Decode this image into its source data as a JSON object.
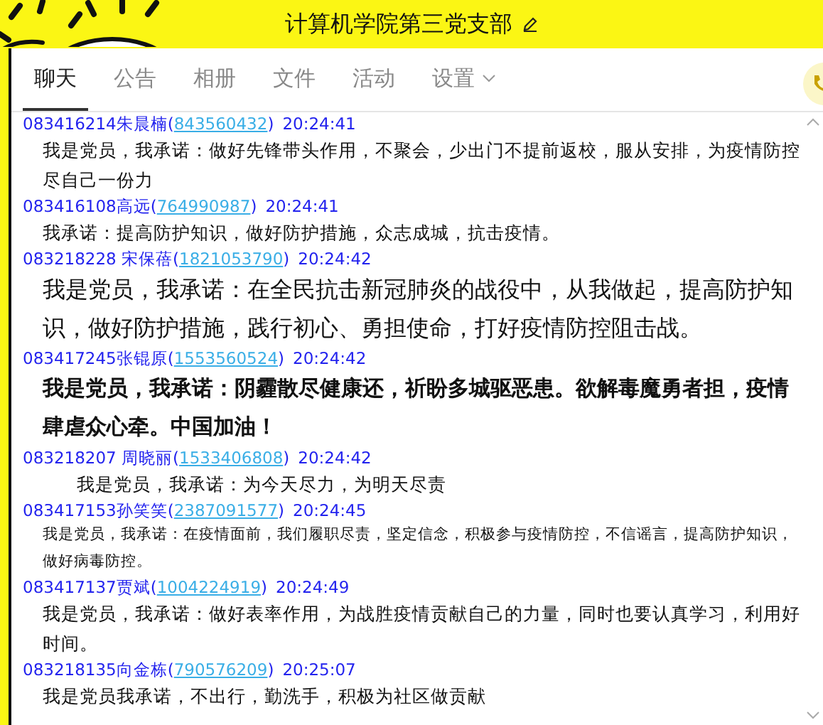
{
  "window": {
    "title": "计算机学院第三党支部"
  },
  "tabs": [
    {
      "label": "聊天",
      "selected": true,
      "dropdown": false
    },
    {
      "label": "公告",
      "selected": false,
      "dropdown": false
    },
    {
      "label": "相册",
      "selected": false,
      "dropdown": false
    },
    {
      "label": "文件",
      "selected": false,
      "dropdown": false
    },
    {
      "label": "活动",
      "selected": false,
      "dropdown": false
    },
    {
      "label": "设置",
      "selected": false,
      "dropdown": true
    }
  ],
  "messages": [
    {
      "sender": "083416214朱晨楠(",
      "qq": "843560432",
      "qq_close": ")",
      "time": "20:24:41",
      "text": "我是党员，我承诺：做好先锋带头作用，不聚会，少出门不提前返校，服从安排，为疫情防控尽自己一份力",
      "kind": "normal",
      "indented": false
    },
    {
      "sender": "083416108高远(",
      "qq": "764990987",
      "qq_close": ")",
      "time": "20:24:41",
      "text": "我承诺：提高防护知识，做好防护措施，众志成城，抗击疫情。",
      "kind": "normal",
      "indented": false
    },
    {
      "sender": "083218228 宋保蓓(",
      "qq": "1821053790",
      "qq_close": ")",
      "time": "20:24:42",
      "text": "我是党员，我承诺：在全民抗击新冠肺炎的战役中，从我做起，提高防护知识，做好防护措施，践行初心、勇担使命，打好疫情防控阻击战。",
      "kind": "large",
      "indented": false
    },
    {
      "sender": "083417245张锟原(",
      "qq": "1553560524",
      "qq_close": ")",
      "time": "20:24:42",
      "text": "我是党员，我承诺：阴霾散尽健康还，祈盼多城驱恶患。欲解毒魔勇者担，疫情肆虐众心牵。中国加油！",
      "kind": "bold",
      "indented": false
    },
    {
      "sender": "083218207 周晓丽(",
      "qq": "1533406808",
      "qq_close": ")",
      "time": "20:24:42",
      "text": "我是党员，我承诺：为今天尽力，为明天尽责",
      "kind": "normal",
      "indented": true
    },
    {
      "sender": "083417153孙笑笑(",
      "qq": "2387091577",
      "qq_close": ")",
      "time": "20:24:45",
      "text": "我是党员，我承诺：在疫情面前，我们履职尽责，坚定信念，积极参与疫情防控，不信谣言，提高防护知识，做好病毒防控。",
      "kind": "small",
      "indented": false
    },
    {
      "sender": "083417137贾斌(",
      "qq": "1004224919",
      "qq_close": ")",
      "time": "20:24:49",
      "text": "我是党员，我承诺：做好表率作用，为战胜疫情贡献自己的力量，同时也要认真学习，利用好时间。",
      "kind": "normal",
      "indented": false
    },
    {
      "sender": "083218135向金栋(",
      "qq": "790576209",
      "qq_close": ")",
      "time": "20:25:07",
      "text": "我是党员我承诺，不出行，勤洗手，积极为社区做贡献",
      "kind": "normal",
      "indented": false
    }
  ]
}
